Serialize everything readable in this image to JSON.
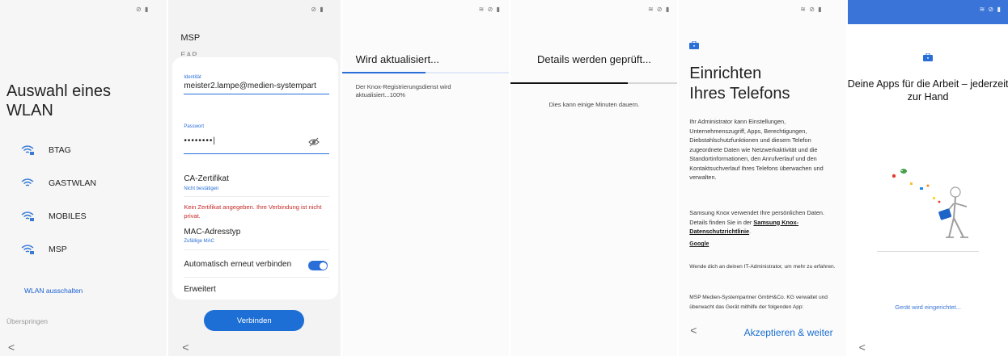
{
  "status": {
    "icons_left": "⊘ ▮",
    "icons_full": "≋ ⊘ ▮"
  },
  "screen1": {
    "title": "Auswahl eines WLAN",
    "networks": [
      {
        "name": "BTAG",
        "icon": "wifi-lock-icon"
      },
      {
        "name": "GASTWLAN",
        "icon": "wifi-icon"
      },
      {
        "name": "MOBILES",
        "icon": "wifi-lock-icon"
      },
      {
        "name": "MSP",
        "icon": "wifi-lock-icon"
      }
    ],
    "wifi_off": "WLAN ausschalten",
    "skip": "Überspringen",
    "back": "<"
  },
  "screen2": {
    "header": "MSP",
    "cut_text": "EAP",
    "identity_label": "Identität",
    "identity_value": "meister2.lampe@medien-systempart",
    "password_label": "Passwort",
    "password_value": "••••••••|",
    "ca_title": "CA-Zertifikat",
    "ca_sub": "Nicht bestätigen",
    "error": "Kein Zertifikat angegeben. Ihre Verbindung ist nicht privat.",
    "mac_title": "MAC-Adresstyp",
    "mac_sub": "Zufällige MAC",
    "auto_reconnect": "Automatisch erneut verbinden",
    "auto_reconnect_on": true,
    "advanced": "Erweitert",
    "connect": "Verbinden",
    "back": "<"
  },
  "screen3": {
    "title": "Wird aktualisiert...",
    "progress": 0.5,
    "message": "Der Knox-Registrierungsdienst wird aktualisiert...100%"
  },
  "screen4": {
    "title": "Details werden geprüft...",
    "progress": 0.7,
    "message": "Dies kann einige Minuten dauern."
  },
  "screen5": {
    "title_line1": "Einrichten",
    "title_line2": "Ihres Telefons",
    "para1": "Ihr Administrator kann Einstellungen, Unternehmenszugriff, Apps, Berechtigungen, Diebstahlschutzfunktionen und diesem Telefon zugeordnete Daten wie Netzwerkaktivität und die Standortinformationen, den Anrufverlauf und den Kontaktsuchverlauf Ihres Telefons überwachen und verwalten.",
    "para2_prefix": "Samsung Knox verwendet Ihre persönlichen Daten. Details finden Sie in der ",
    "para2_link": "Samsung Knox-Datenschutzrichtlinie",
    "para2_suffix": ".",
    "google": "Google",
    "contact": "Wende dich an deinen IT-Administrator, um mehr zu erfahren.",
    "company": "MSP Medien-Systempartner GmbH&Co. KG verwaltet und überwacht das Gerät mithilfe der folgenden App:",
    "accept": "Akzeptieren & weiter",
    "back": "<"
  },
  "screen6": {
    "heading": "Deine Apps für die Arbeit – jederzeit zur Hand",
    "setup": "Gerät wird eingerichtet...",
    "back": "<"
  },
  "colors": {
    "accent": "#1d6fd6",
    "error": "#c62828",
    "header_blue": "#3a74d8"
  }
}
